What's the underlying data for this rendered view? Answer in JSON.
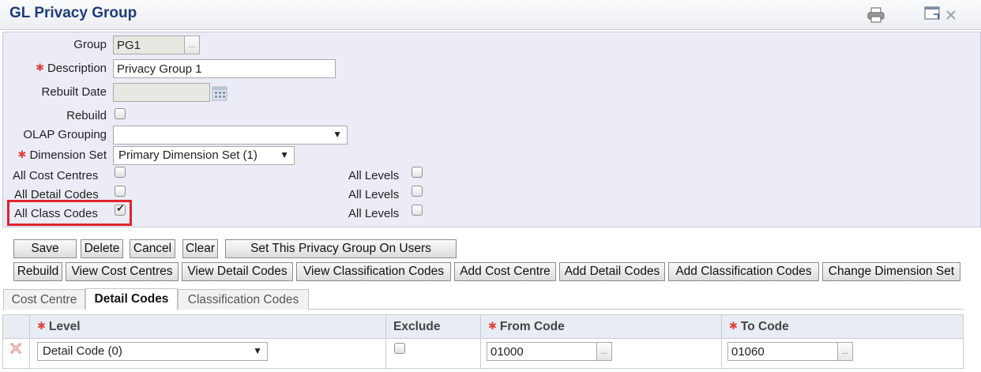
{
  "header": {
    "title": "GL Privacy Group"
  },
  "icons": {
    "print": "printer-icon",
    "window": "new-window-icon",
    "close": "close-icon"
  },
  "form": {
    "group": {
      "label": "Group",
      "value": "PG1",
      "lookup": "..."
    },
    "description": {
      "label": "Description",
      "value": "Privacy Group 1",
      "required": "✱"
    },
    "rebuilt_date": {
      "label": "Rebuilt Date",
      "value": ""
    },
    "rebuild": {
      "label": "Rebuild",
      "checked": false
    },
    "olap_grouping": {
      "label": "OLAP Grouping",
      "value": "",
      "arrow": "▼"
    },
    "dimension_set": {
      "label": "Dimension Set",
      "value": "Primary Dimension Set (1)",
      "arrow": "▼",
      "required": "✱"
    },
    "all_cost_centres": {
      "label": "All Cost Centres",
      "checked": false
    },
    "all_detail_codes": {
      "label": "All Detail Codes",
      "checked": false
    },
    "all_class_codes": {
      "label": "All Class Codes",
      "checked": true
    },
    "all_levels_1": {
      "label": "All Levels",
      "checked": false
    },
    "all_levels_2": {
      "label": "All Levels",
      "checked": false
    },
    "all_levels_3": {
      "label": "All Levels",
      "checked": false
    }
  },
  "toolbar1": {
    "save": "Save",
    "delete": "Delete",
    "cancel": "Cancel",
    "clear": "Clear",
    "set_on_users": "Set This Privacy Group On Users"
  },
  "toolbar2": {
    "rebuild": "Rebuild",
    "view_cost_centres": "View Cost Centres",
    "view_detail_codes": "View Detail Codes",
    "view_classification_codes": "View Classification Codes",
    "add_cost_centre": "Add Cost Centre",
    "add_detail_codes": "Add Detail Codes",
    "add_classification_codes": "Add Classification Codes",
    "change_dimension_set": "Change Dimension Set"
  },
  "tabs": [
    {
      "label": "Cost Centre",
      "active": false
    },
    {
      "label": "Detail Codes",
      "active": true
    },
    {
      "label": "Classification Codes",
      "active": false
    }
  ],
  "grid": {
    "columns": {
      "level": "Level",
      "exclude": "Exclude",
      "from_code": "From Code",
      "to_code": "To Code"
    },
    "required_mark": "✱",
    "rows": [
      {
        "level": "Detail Code (0)",
        "exclude": false,
        "from_code": "01000",
        "to_code": "01060"
      }
    ],
    "lookup": "...",
    "arrow": "▼"
  },
  "colors": {
    "title": "#1d3c7a",
    "form_bg": "#ececf7",
    "required": "#e0423b",
    "highlight": "#e0252b"
  }
}
